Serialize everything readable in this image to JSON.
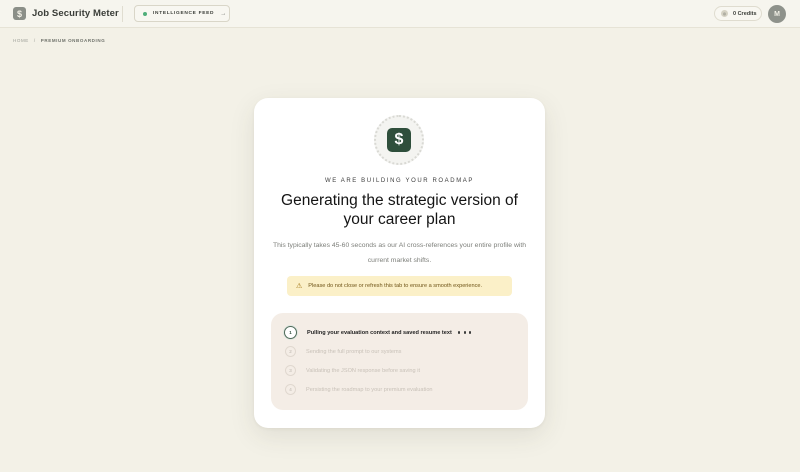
{
  "app": {
    "logo_glyph": "$",
    "name": "Job Security Meter"
  },
  "header": {
    "feed_button": {
      "label": "INTELLIGENCE FEED",
      "arrow": "→"
    },
    "credits": {
      "icon": "◎",
      "label": "0 Credits"
    },
    "avatar_initial": "M"
  },
  "breadcrumb": {
    "home": "HOME",
    "separator": "/",
    "current": "PREMIUM ONBOARDING"
  },
  "card": {
    "badge_glyph": "$",
    "eyebrow": "WE ARE BUILDING YOUR ROADMAP",
    "headline": "Generating the strategic version of your career plan",
    "subtext": "This typically takes 45-60 seconds as our AI cross-references your entire profile with current market shifts.",
    "warning": {
      "icon": "⚠",
      "text": "Please do not close or refresh this tab to ensure a smooth experience."
    },
    "steps": [
      {
        "num": "1",
        "label": "Pulling your evaluation context and saved resume text",
        "active": true
      },
      {
        "num": "2",
        "label": "Sending the full prompt to our systems",
        "active": false
      },
      {
        "num": "3",
        "label": "Validating the JSON response before saving it",
        "active": false
      },
      {
        "num": "4",
        "label": "Persisting the roadmap to your premium evaluation",
        "active": false
      }
    ]
  },
  "colors": {
    "background": "#f3f1e7",
    "brand_green": "#2f4f3c",
    "warning_bg": "#fbf0c8",
    "steps_bg": "#f4ede6",
    "feed_dot": "#4fae7a"
  },
  "icons": {
    "brand": "dollar-logo-icon",
    "feed_status": "status-dot-icon",
    "feed_arrow": "arrow-right-icon",
    "credits": "coin-icon",
    "badge": "dollar-badge-icon",
    "warning": "warning-triangle-icon"
  }
}
